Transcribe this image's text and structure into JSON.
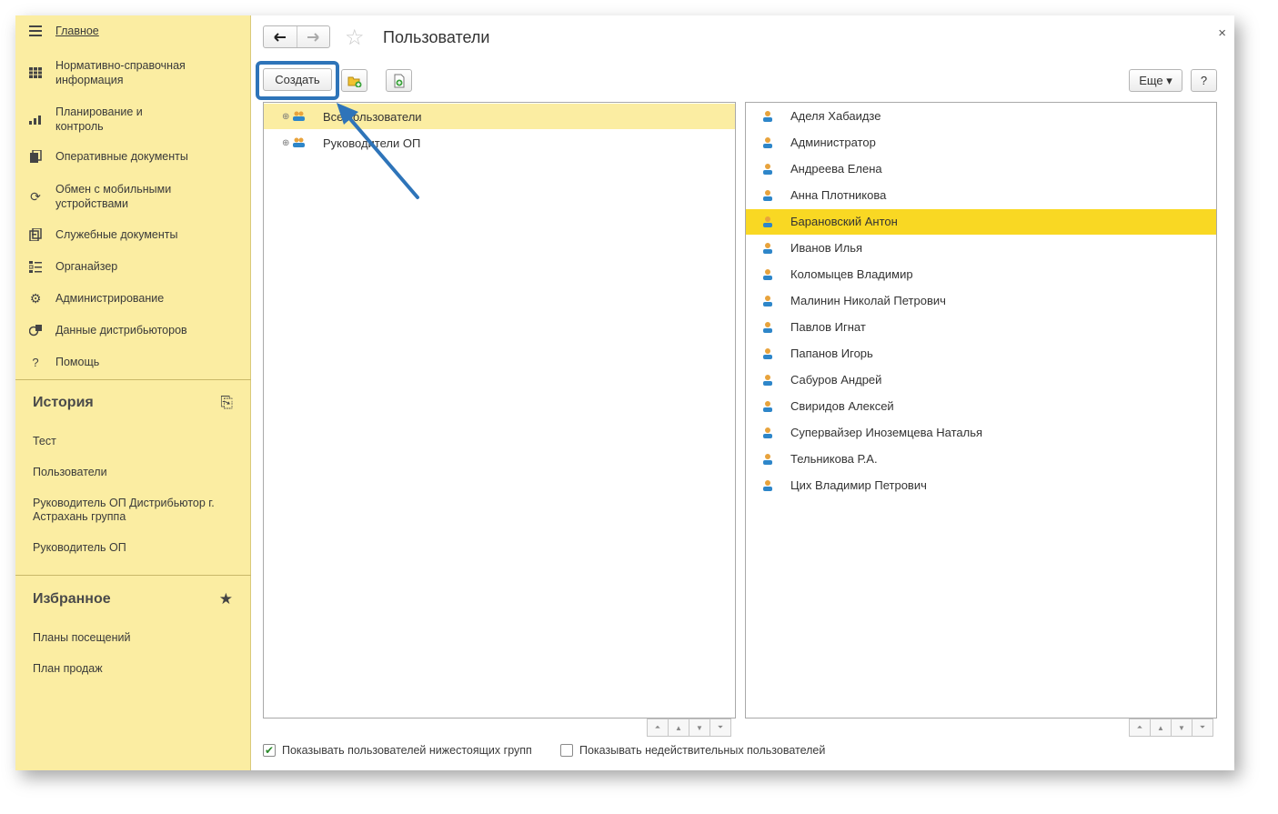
{
  "sidebar": {
    "items": [
      {
        "label": "Главное",
        "icon": "menu-icon"
      },
      {
        "label": "Нормативно-справочная информация",
        "icon": "grid-icon"
      },
      {
        "label": "Планирование и контроль",
        "icon": "chart-icon"
      },
      {
        "label": "Оперативные документы",
        "icon": "documents-icon"
      },
      {
        "label": "Обмен с мобильными устройствами",
        "icon": "sync-icon"
      },
      {
        "label": "Служебные документы",
        "icon": "service-docs-icon"
      },
      {
        "label": "Органайзер",
        "icon": "organizer-icon"
      },
      {
        "label": "Администрирование",
        "icon": "gear-icon"
      },
      {
        "label": "Данные дистрибьюторов",
        "icon": "distributors-icon"
      },
      {
        "label": "Помощь",
        "icon": "help-icon"
      }
    ],
    "history": {
      "title": "История",
      "items": [
        "Тест",
        "Пользователи",
        "Руководитель ОП Дистрибьютор г. Астрахань группа",
        "Руководитель ОП"
      ]
    },
    "favorites": {
      "title": "Избранное",
      "items": [
        "Планы посещений",
        "План продаж"
      ]
    }
  },
  "form": {
    "title": "Пользователи",
    "close_label": "×",
    "back_label": "🡐",
    "forward_label": "🡒"
  },
  "toolbar": {
    "create_label": "Создать",
    "more_label": "Еще ▾",
    "help_label": "?"
  },
  "groups": [
    {
      "label": "Все пользователи",
      "selected": true
    },
    {
      "label": "Руководители ОП",
      "selected": false
    }
  ],
  "users": [
    {
      "name": "Аделя Хабаидзе"
    },
    {
      "name": "Администратор"
    },
    {
      "name": "Андреева Елена"
    },
    {
      "name": "Анна Плотникова"
    },
    {
      "name": "Барановский Антон",
      "selected": true
    },
    {
      "name": "Иванов Илья"
    },
    {
      "name": "Коломыцев Владимир"
    },
    {
      "name": "Малинин Николай Петрович"
    },
    {
      "name": "Павлов Игнат"
    },
    {
      "name": "Папанов Игорь"
    },
    {
      "name": "Сабуров Андрей"
    },
    {
      "name": "Свиридов Алексей"
    },
    {
      "name": "Супервайзер Иноземцева Наталья"
    },
    {
      "name": "Тельникова Р.А."
    },
    {
      "name": "Цих Владимир Петрович"
    }
  ],
  "options": {
    "show_subgroups_label": "Показывать пользователей нижестоящих групп",
    "show_subgroups_checked": true,
    "show_invalid_label": "Показывать недействительных пользователей",
    "show_invalid_checked": false
  },
  "colors": {
    "sidebar_bg": "#fbeda2",
    "tree_selected": "#fbeda2",
    "list_selected": "#f9d823",
    "highlight": "#2e74b9"
  }
}
